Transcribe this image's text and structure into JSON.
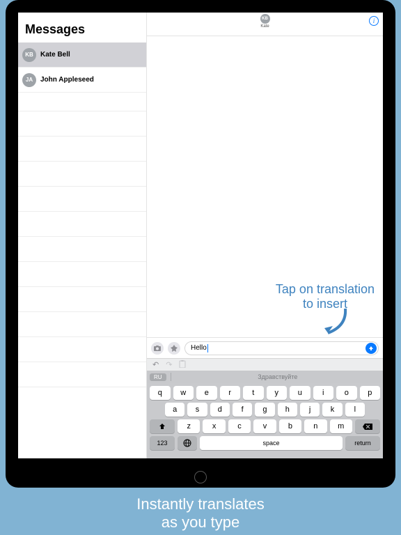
{
  "sidebar": {
    "title": "Messages",
    "conversations": [
      {
        "initials": "KB",
        "name": "Kate Bell",
        "selected": true
      },
      {
        "initials": "JA",
        "name": "John Appleseed",
        "selected": false
      }
    ]
  },
  "chat": {
    "header": {
      "initials": "KB",
      "name": "Kate"
    },
    "compose_value": "Hello"
  },
  "callout": {
    "line1": "Tap on translation",
    "line2": "to insert"
  },
  "suggestion": {
    "lang": "RU",
    "text": "Здравствуйте"
  },
  "keyboard": {
    "row1": [
      "q",
      "w",
      "e",
      "r",
      "t",
      "y",
      "u",
      "i",
      "o",
      "p"
    ],
    "row2": [
      "a",
      "s",
      "d",
      "f",
      "g",
      "h",
      "j",
      "k",
      "l"
    ],
    "row3": [
      "z",
      "x",
      "c",
      "v",
      "b",
      "n",
      "m"
    ],
    "numLabel": "123",
    "spaceLabel": "space",
    "returnLabel": "return"
  },
  "marketing": {
    "line1": "Instantly translates",
    "line2": "as you type"
  }
}
